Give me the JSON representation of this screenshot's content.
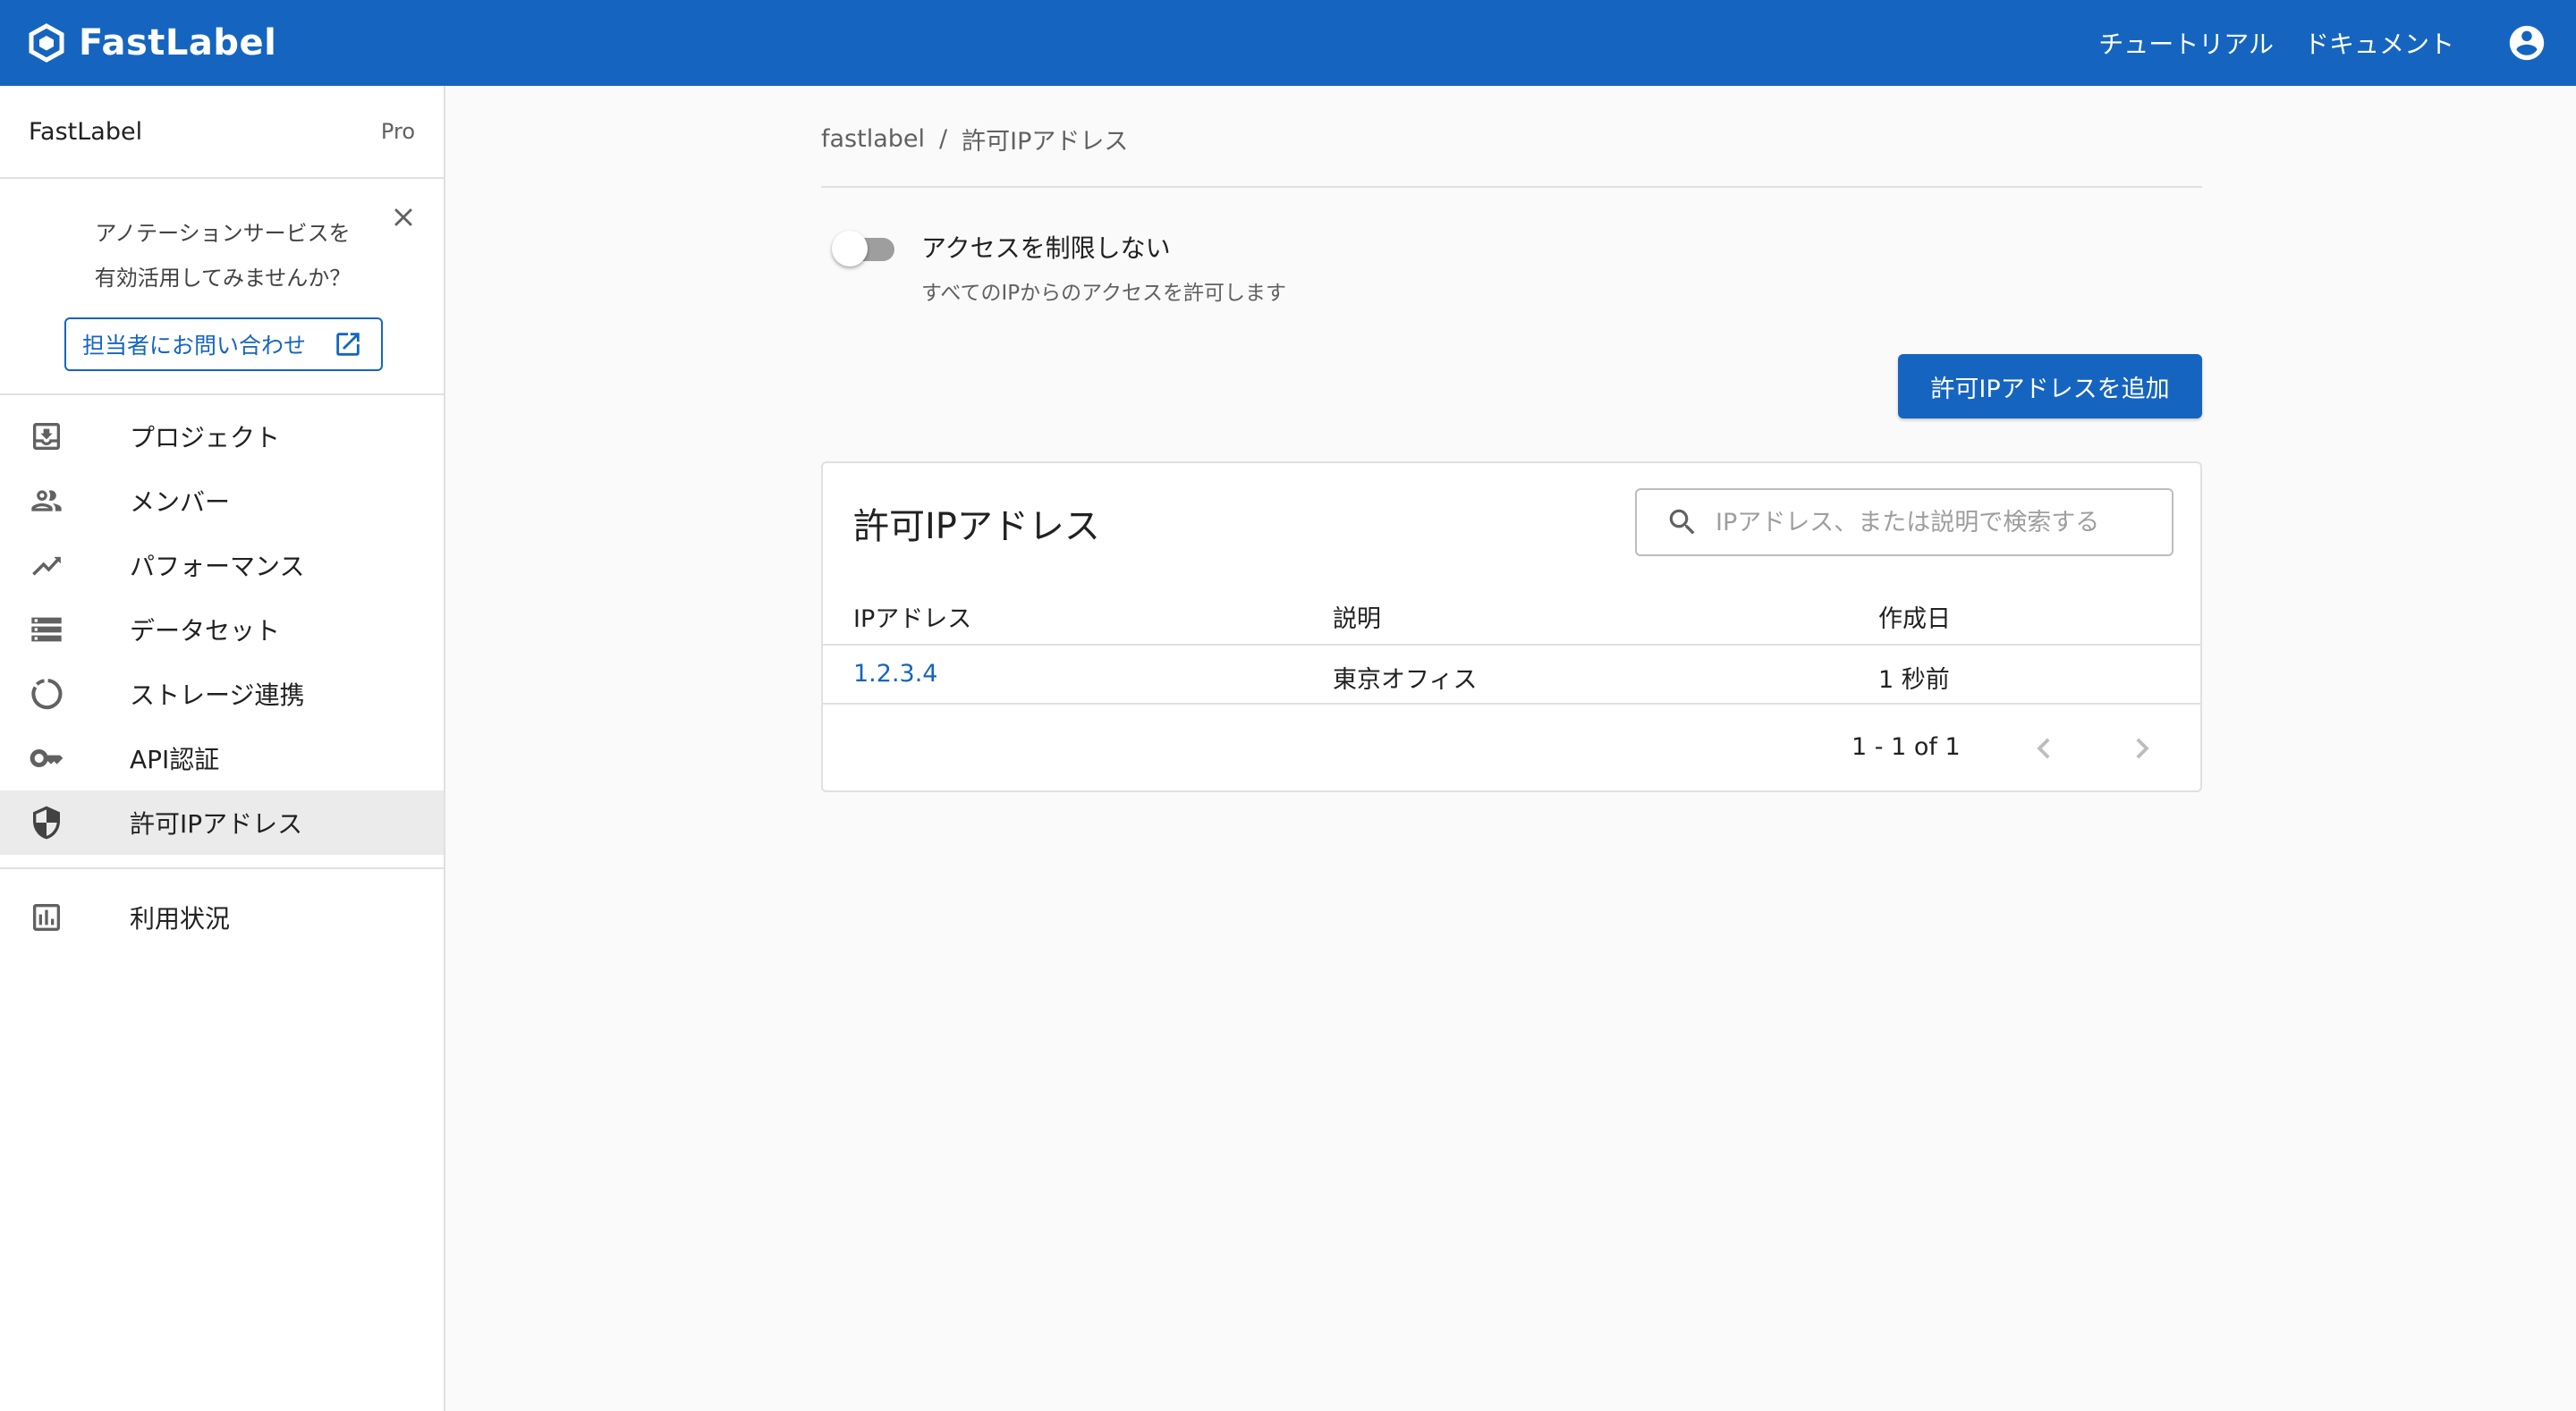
{
  "header": {
    "brand": "FastLabel",
    "links": [
      "チュートリアル",
      "ドキュメント"
    ],
    "brand_color": "#1565c0"
  },
  "sidebar": {
    "workspace_name": "FastLabel",
    "workspace_plan": "Pro",
    "promo": {
      "line1": "アノテーションサービスを",
      "line2": "有効活用してみませんか？",
      "button": "担当者にお問い合わせ"
    },
    "items": [
      {
        "label": "プロジェクト",
        "icon": "download-box-icon"
      },
      {
        "label": "メンバー",
        "icon": "people-icon"
      },
      {
        "label": "パフォーマンス",
        "icon": "trending-icon"
      },
      {
        "label": "データセット",
        "icon": "storage-icon"
      },
      {
        "label": "ストレージ連携",
        "icon": "sync-circle-icon"
      },
      {
        "label": "API認証",
        "icon": "key-icon"
      },
      {
        "label": "許可IPアドレス",
        "icon": "shield-icon",
        "active": true
      }
    ],
    "footer_items": [
      {
        "label": "利用状況",
        "icon": "bar-chart-icon"
      }
    ]
  },
  "main": {
    "breadcrumb": {
      "root": "fastlabel",
      "separator": "/",
      "current": "許可IPアドレス"
    },
    "access_toggle": {
      "label": "アクセスを制限しない",
      "help": "すべてのIPからのアクセスを許可します",
      "checked": false
    },
    "add_button": "許可IPアドレスを追加",
    "table": {
      "title": "許可IPアドレス",
      "search_placeholder": "IPアドレス、または説明で検索する",
      "columns": [
        "IPアドレス",
        "説明",
        "作成日"
      ],
      "rows": [
        {
          "ip": "1.2.3.4",
          "description": "東京オフィス",
          "created": "1 秒前"
        }
      ],
      "pagination": "1 - 1 of 1"
    }
  }
}
